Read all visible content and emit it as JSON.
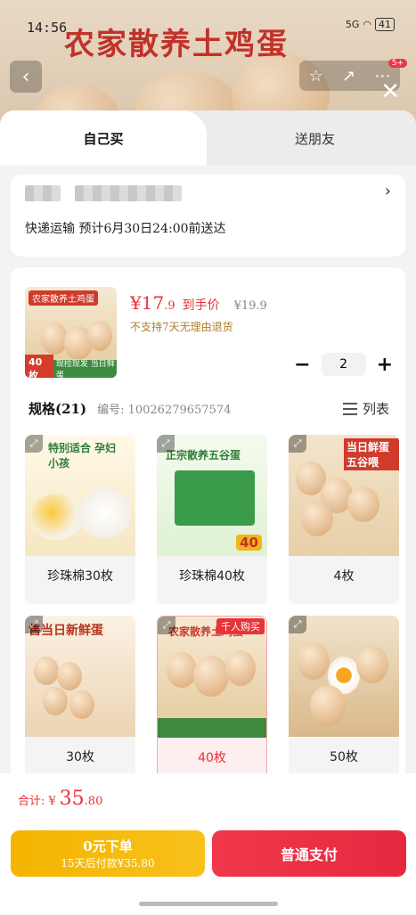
{
  "status_bar": {
    "time": "14:56",
    "signal": "5G",
    "battery": "41"
  },
  "background": {
    "banner_title": "农家散养土鸡蛋",
    "notification_count": "5+"
  },
  "tabs": [
    {
      "label": "自己买"
    },
    {
      "label": "送朋友"
    }
  ],
  "address": {
    "delivery_text": "快递运输 预计6月30日24:00前送达"
  },
  "product": {
    "thumb_title": "农家散养土鸡蛋",
    "thumb_count": "40枚",
    "thumb_caption": "现捡现发 当日鲜蛋",
    "currency": "¥",
    "price_int": "17",
    "price_dec": ".9",
    "price_label": "到手价",
    "price_original": "¥19.9",
    "return_policy": "不支持7天无理由退货",
    "quantity": "2"
  },
  "specs": {
    "title": "规格(21)",
    "code": "编号: 10026279657574",
    "list_toggle_label": "列表",
    "items": [
      {
        "label": "珍珠棉30枚",
        "img_text": "特别适合 孕妇小孩"
      },
      {
        "label": "珍珠棉40枚",
        "img_text": "正宗散养五谷蛋"
      },
      {
        "label": "4枚",
        "img_text": "当日鲜蛋 五谷喂"
      },
      {
        "label": "30枚",
        "img_text": "售当日新鲜蛋"
      },
      {
        "label": "40枚",
        "img_text": "农家散养土鸡蛋",
        "tag": "千人购买"
      },
      {
        "label": "50枚",
        "img_text": ""
      }
    ]
  },
  "footer": {
    "total_label": "合计:",
    "total_currency": "¥",
    "total_int": "35",
    "total_dec": ".80",
    "credit_btn_line1": "0元下单",
    "credit_btn_line2": "15天后付款¥35.80",
    "pay_btn": "普通支付"
  },
  "colors": {
    "accent": "#e8333a",
    "credit": "#f5b400",
    "return_text": "#b07d2a"
  }
}
